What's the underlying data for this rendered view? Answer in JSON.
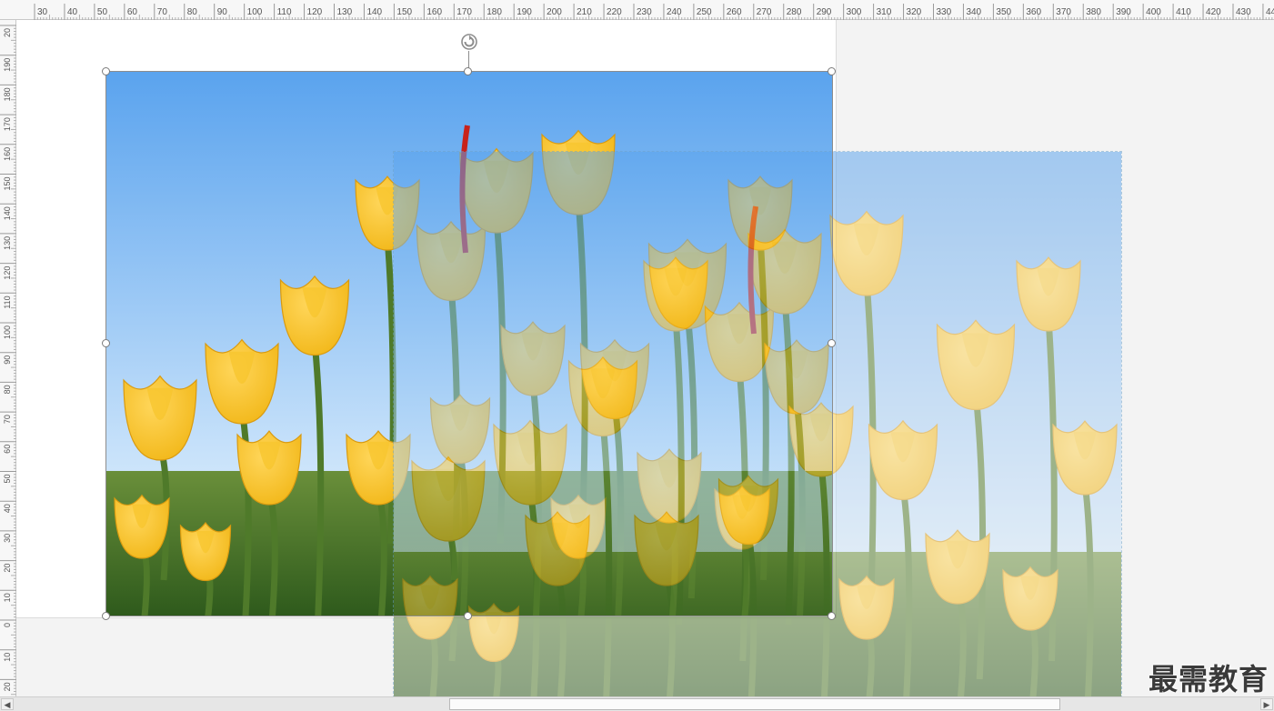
{
  "ruler": {
    "horizontal": [
      "30",
      "40",
      "50",
      "60",
      "70",
      "80",
      "90",
      "100",
      "110",
      "120",
      "130",
      "140",
      "150",
      "160",
      "170",
      "180",
      "190",
      "200",
      "210",
      "220",
      "230",
      "240",
      "250",
      "260",
      "270",
      "280",
      "290",
      "300",
      "310",
      "320",
      "330",
      "340",
      "350",
      "360",
      "370",
      "380",
      "390",
      "400",
      "410",
      "420",
      "430",
      "44"
    ],
    "vertical": [
      "20",
      "190",
      "180",
      "170",
      "160",
      "150",
      "140",
      "130",
      "120",
      "110",
      "100",
      "90",
      "80",
      "70",
      "60",
      "50",
      "40",
      "30",
      "20",
      "10",
      "0",
      "10",
      "20"
    ]
  },
  "image": {
    "subject": "yellow-tulips",
    "sky_top": "#5aa3ee",
    "sky_bottom": "#cfe6fb",
    "petal": "#f2b81a",
    "petal_light": "#ffd65a",
    "stem": "#4f7a2a",
    "ground": "#2e5a1c"
  },
  "icons": {
    "rotate": "rotate-handle-icon",
    "scroll_left": "scroll-left-icon",
    "scroll_right": "scroll-right-icon"
  },
  "watermark": {
    "text": "最需教育"
  }
}
